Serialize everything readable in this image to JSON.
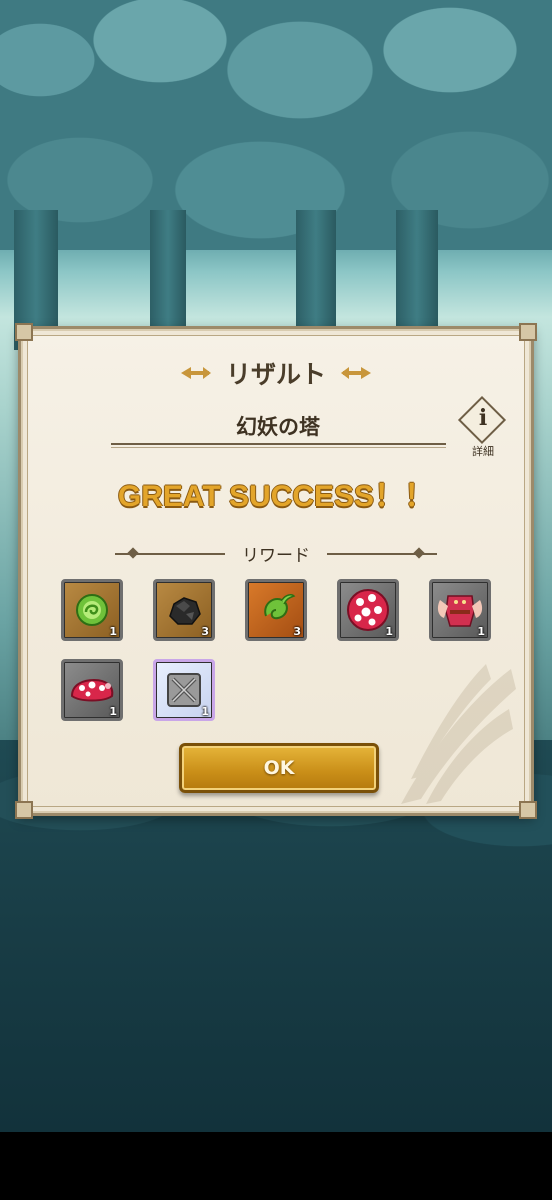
{
  "dialog": {
    "title": "リザルト",
    "stage_name": "幻妖の塔",
    "info_label": "詳細",
    "info_glyph": "i",
    "result_text": "GREAT SUCCESS！！",
    "reward_header": "リワード",
    "ok_label": "OK"
  },
  "rewards": [
    {
      "name": "green-orb",
      "frame": "brown",
      "qty": "1"
    },
    {
      "name": "black-ore",
      "frame": "brown",
      "qty": "3"
    },
    {
      "name": "green-swirl-fruit",
      "frame": "orange",
      "qty": "3"
    },
    {
      "name": "spotted-mushroom-ball",
      "frame": "grey",
      "qty": "1"
    },
    {
      "name": "red-mushroom-costume",
      "frame": "grey",
      "qty": "1"
    },
    {
      "name": "mushroom-cap-hat",
      "frame": "grey",
      "qty": "1"
    },
    {
      "name": "locked-slot",
      "frame": "rainbow",
      "qty": "1"
    }
  ],
  "colors": {
    "accent_gold": "#e3a52a",
    "panel": "#f3ecdd",
    "text": "#3e3222"
  }
}
